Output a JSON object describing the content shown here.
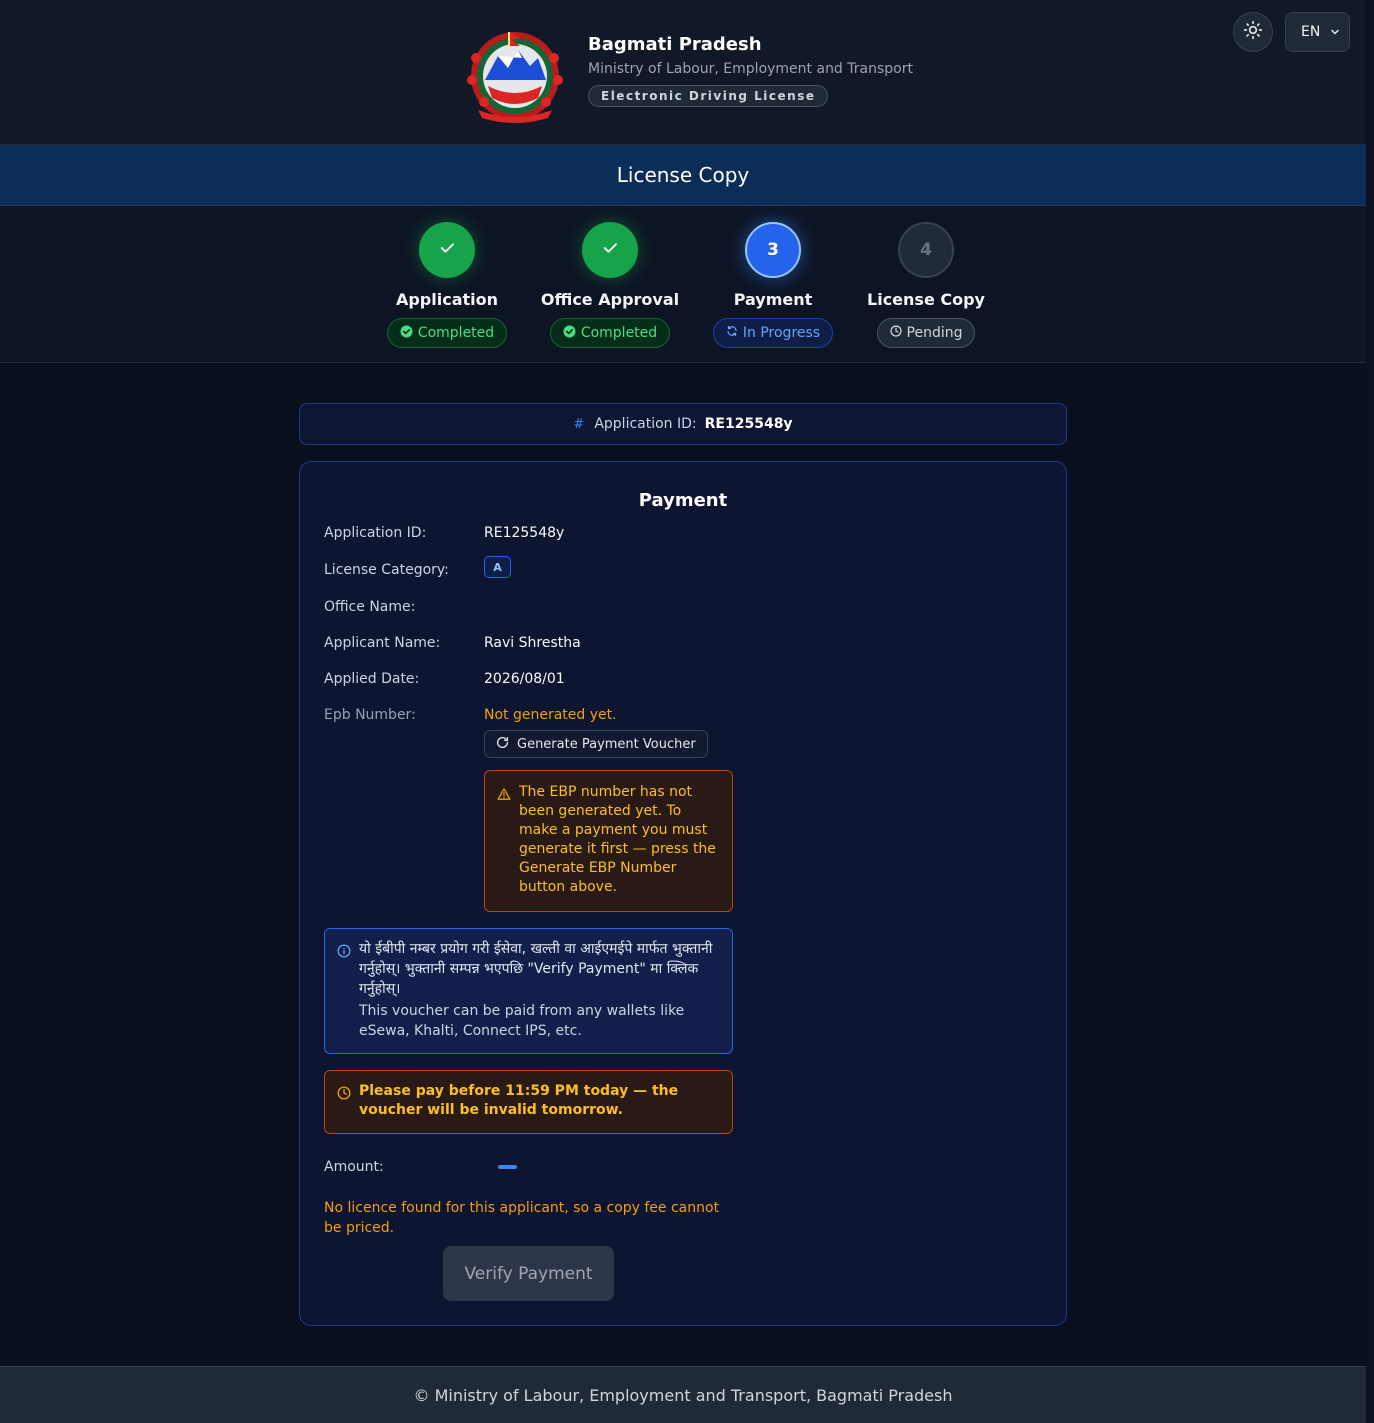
{
  "header": {
    "title": "Bagmati Pradesh",
    "subtitle": "Ministry of Labour, Employment and Transport",
    "pill": "Electronic Driving License",
    "language": "EN"
  },
  "page_title": "License Copy",
  "stepper": {
    "steps": [
      {
        "label": "Application",
        "status": "Completed",
        "marker": "✓",
        "state": "done"
      },
      {
        "label": "Office Approval",
        "status": "Completed",
        "marker": "✓",
        "state": "done"
      },
      {
        "label": "Payment",
        "status": "In Progress",
        "marker": "3",
        "state": "active"
      },
      {
        "label": "License Copy",
        "status": "Pending",
        "marker": "4",
        "state": "pending"
      }
    ]
  },
  "appid_bar": {
    "label": "Application ID:",
    "value": "RE125548y"
  },
  "payment": {
    "title": "Payment",
    "application_id_label": "Application ID:",
    "application_id": "RE125548y",
    "category_label": "License Category:",
    "category": "A",
    "office_label": "Office Name:",
    "office": "",
    "applicant_label": "Applicant Name:",
    "applicant": "Ravi Shrestha",
    "applied_date_label": "Applied Date:",
    "applied_date": "2026/08/01",
    "epb_label": "Epb Number:",
    "epb_value": "Not generated yet.",
    "generate_button": "Generate Payment Voucher",
    "ebp_warning": "The EBP number has not been generated yet. To make a payment you must generate it first — press the Generate EBP Number button above.",
    "info_nepali": "यो ईबीपी नम्बर प्रयोग गरी ईसेवा, खल्ती वा आईएमईपे मार्फत भुक्तानी गर्नुहोस्। भुक्तानी सम्पन्न भएपछि \"Verify Payment\" मा क्लिक गर्नुहोस्।",
    "info_english": "This voucher can be paid from any wallets like eSewa, Khalti, Connect IPS, etc.",
    "deadline_notice": "Please pay before 11:59 PM today — the voucher will be invalid tomorrow.",
    "amount_label": "Amount:",
    "no_licence_notice": "No licence found for this applicant, so a copy fee cannot be priced.",
    "verify_button": "Verify Payment"
  },
  "footer": "© Ministry of Labour, Employment and Transport, Bagmati Pradesh",
  "colors": {
    "accent": "#2563eb",
    "success": "#16a34a",
    "warning": "#f59e0b",
    "background": "#0a0f1e"
  },
  "icons": [
    "nepal-emblem",
    "sun-icon",
    "chevron-down-icon",
    "check-icon",
    "check-circle-icon",
    "refresh-icon",
    "clock-icon",
    "hash-icon",
    "warning-triangle-icon",
    "info-icon"
  ]
}
